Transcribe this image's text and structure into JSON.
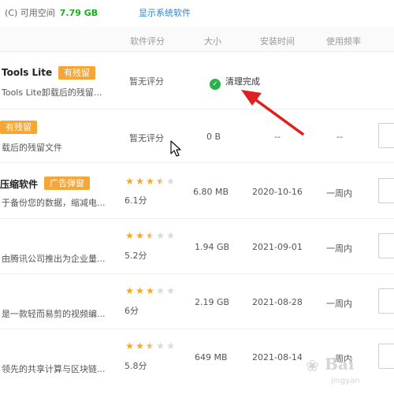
{
  "topbar": {
    "drive_label": "(C) 可用空间",
    "free_space": "7.79 GB",
    "show_system_label": "显示系统软件"
  },
  "header": {
    "rating": "软件评分",
    "size": "大小",
    "install_time": "安装时间",
    "frequency": "使用频率"
  },
  "rows": [
    {
      "name": "Tools Lite",
      "badge": "有残留",
      "desc": "Tools Lite卸载后的残留...",
      "rating_text": "暂无评分",
      "status": "清理完成"
    },
    {
      "name": "",
      "badge": "有残留",
      "desc": "载后的残留文件",
      "rating_text": "暂无评分",
      "size": "0 B",
      "install_time": "--",
      "frequency": "--"
    },
    {
      "name": "压缩软件",
      "badge": "广告弹窗",
      "desc": "于备份您的数据，缩减电...",
      "stars": 3.5,
      "score": "6.1分",
      "size": "6.80 MB",
      "install_time": "2020-10-16",
      "frequency": "一周内"
    },
    {
      "name": "",
      "desc": "由腾讯公司推出为企业量...",
      "stars": 2.5,
      "score": "5.2分",
      "size": "1.94 GB",
      "install_time": "2021-09-01",
      "frequency": "一周内"
    },
    {
      "name": "",
      "desc": "是一款轻而易剪的视频编...",
      "stars": 3,
      "score": "6分",
      "size": "2.19 GB",
      "install_time": "2021-08-28",
      "frequency": "一周内"
    },
    {
      "name": "",
      "desc": "领先的共享计算与区块链...",
      "stars": 2.5,
      "score": "5.8分",
      "size": "649 MB",
      "install_time": "2021-08-14",
      "frequency": "一周内"
    }
  ],
  "colors": {
    "badge": "#f5a636",
    "star": "#f7a623",
    "success": "#27b24a",
    "link": "#2f7fd8",
    "free_space": "#1aad19",
    "arrow": "#e02020"
  },
  "watermark": {
    "text": "Bai",
    "sub": "jingyan"
  },
  "icons": {
    "status": "check-circle-icon",
    "star": "star-icon",
    "pointer": "mouse-cursor-icon",
    "annotation": "red-arrow-icon"
  }
}
